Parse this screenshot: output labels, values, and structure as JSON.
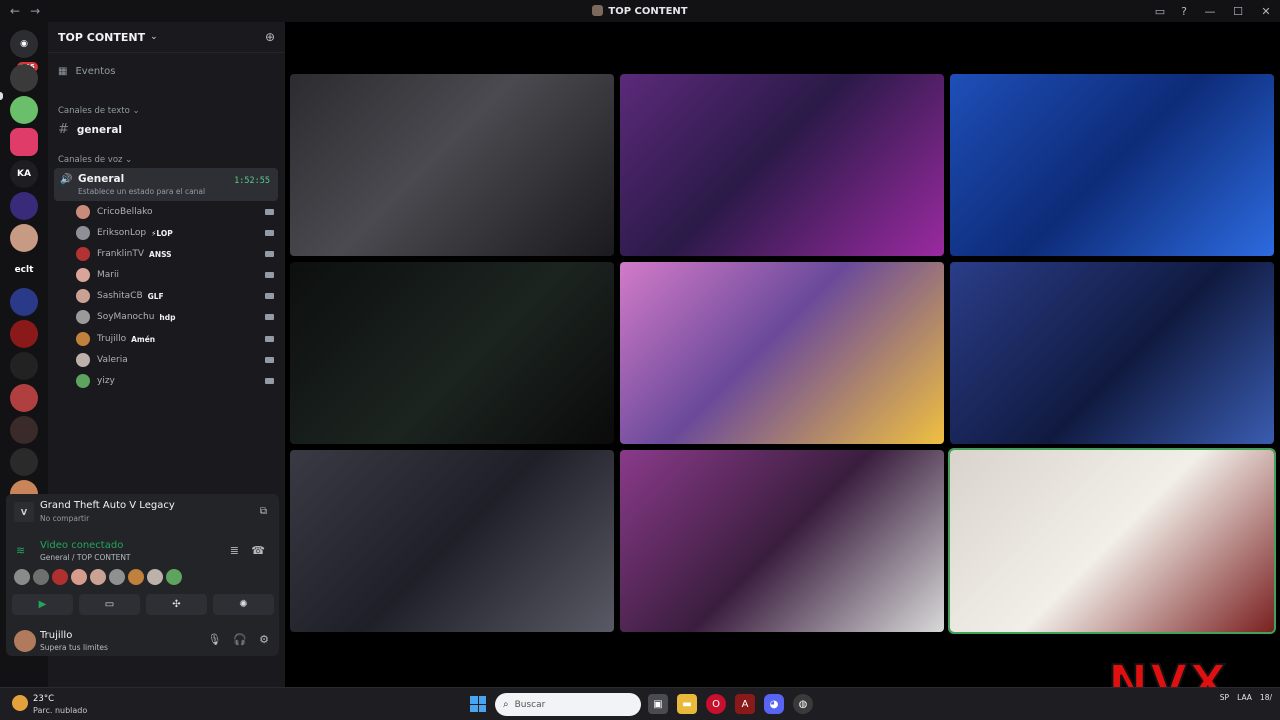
{
  "window": {
    "title": "TOP CONTENT",
    "back_glyph": "←",
    "forward_glyph": "→",
    "icons": [
      "inbox-icon",
      "help-icon",
      "minimize-icon",
      "maximize-icon",
      "close-icon"
    ]
  },
  "rail": {
    "home_badge": "546",
    "text_server_label": "eclt"
  },
  "server": {
    "name": "TOP CONTENT",
    "events_label": "Eventos",
    "text_category": "Canales de texto",
    "text_channel": "general",
    "voice_category": "Canales de voz",
    "voice_channel": {
      "name": "General",
      "status_placeholder": "Establece un estado para el canal",
      "elapsed": "1:52:55"
    },
    "members": [
      {
        "name": "CricoBellako",
        "tag": "",
        "color": "#c98c7a"
      },
      {
        "name": "EriksonLop",
        "tag": "⚡LOP",
        "color": "#8f8f99"
      },
      {
        "name": "FranklinTV",
        "tag": "ANSS",
        "color": "#b33333"
      },
      {
        "name": "Marii",
        "tag": "",
        "color": "#d9a59a"
      },
      {
        "name": "SashitaCB",
        "tag": "GLF",
        "color": "#caa293"
      },
      {
        "name": "SoyManochu",
        "tag": "hdp",
        "color": "#9a9a9a"
      },
      {
        "name": "Trujillo",
        "tag": "Amén",
        "color": "#c0813d"
      },
      {
        "name": "Valeria",
        "tag": "",
        "color": "#bcb2aa"
      },
      {
        "name": "yizy",
        "tag": "",
        "color": "#5da55f"
      }
    ]
  },
  "activity": {
    "game": "Grand Theft Auto V Legacy",
    "share_status": "No compartir"
  },
  "voice_connection": {
    "title": "Video conectado",
    "location": "General / TOP CONTENT",
    "avatar_colors": [
      "#8a8a8a",
      "#6f6f6f",
      "#b03030",
      "#d79b8e",
      "#caa293",
      "#909090",
      "#c0813d",
      "#bcb2aa",
      "#5da55f"
    ],
    "buttons": [
      "camera-icon",
      "screen-share-icon",
      "activities-icon",
      "soundboard-icon"
    ]
  },
  "user": {
    "name": "Trujillo",
    "status": "Supera tus limites"
  },
  "tiles": [
    {
      "name": "tile-1",
      "bg": "linear-gradient(135deg,#2b2b30,#4a4a50 45%,#1b1b1e)",
      "speaking": false
    },
    {
      "name": "tile-2",
      "bg": "linear-gradient(135deg,#5b2a7a,#2b1a48 45%,#9a2aa0)",
      "speaking": false
    },
    {
      "name": "tile-3",
      "bg": "linear-gradient(135deg,#1e4fb8,#0d2b78 50%,#2d6be0)",
      "speaking": false
    },
    {
      "name": "tile-4",
      "bg": "linear-gradient(135deg,#0c0f0e,#1c2420 55%,#0a0a0a)",
      "speaking": false
    },
    {
      "name": "tile-5",
      "bg": "linear-gradient(135deg,#d27bc8,#6a4a9a 45%,#f0c040)",
      "speaking": false
    },
    {
      "name": "tile-6",
      "bg": "linear-gradient(135deg,#2a3d88,#101a40 55%,#3a5cb0)",
      "speaking": false
    },
    {
      "name": "tile-7",
      "bg": "linear-gradient(135deg,#3a3a44,#1f1f28 50%,#5a5a66)",
      "speaking": false
    },
    {
      "name": "tile-8",
      "bg": "linear-gradient(135deg,#8a3a8a,#3a1e3e 50%,#d9d9d9)",
      "speaking": false
    },
    {
      "name": "tile-9",
      "bg": "linear-gradient(135deg,#d9d3cc,#f2efe9 50%,#7a2020)",
      "speaking": true
    }
  ],
  "watermark": "NVX",
  "taskbar": {
    "temp": "23°C",
    "weather": "Parc. nublado",
    "search_placeholder": "Buscar",
    "lang": "SP",
    "clock_time": "",
    "clock_date": "18/",
    "lang2": "LAA"
  }
}
